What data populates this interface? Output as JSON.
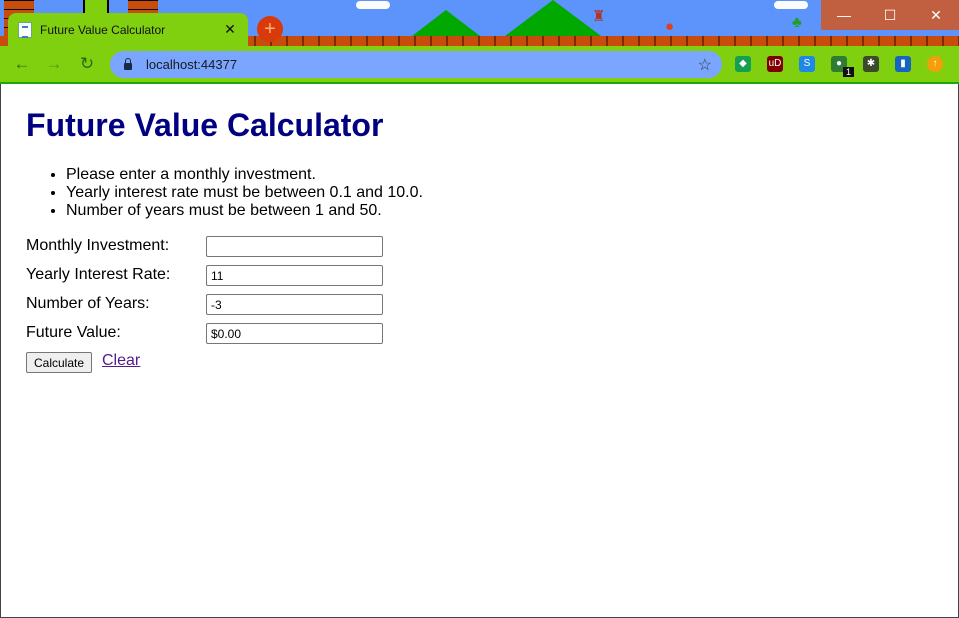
{
  "browser": {
    "tab_title": "Future Value Calculator",
    "tab_close_glyph": "✕",
    "new_tab_glyph": "+",
    "url": "localhost:44377",
    "window_controls": {
      "minimize": "—",
      "maximize": "☐",
      "close": "✕"
    },
    "nav": {
      "back": "←",
      "forward": "→",
      "reload": "↻"
    },
    "star_glyph": "☆",
    "extensions": [
      {
        "name": "green-extension-icon",
        "glyph": "◆",
        "color": "#14a050"
      },
      {
        "name": "ublock-icon",
        "glyph": "uD",
        "color": "#800000"
      },
      {
        "name": "s-extension-icon",
        "glyph": "S",
        "color": "#1e88e5"
      },
      {
        "name": "tampermonkey-icon",
        "glyph": "●",
        "color": "#2e7d32",
        "badge": "1"
      },
      {
        "name": "puzzle-extensions-icon",
        "glyph": "✱",
        "color": "#3a4a2a"
      },
      {
        "name": "profile-avatar-icon",
        "glyph": "▮",
        "color": "#1565c0"
      },
      {
        "name": "update-icon",
        "glyph": "↑",
        "color": "#f59e0b"
      }
    ]
  },
  "page": {
    "heading": "Future Value Calculator",
    "errors": [
      "Please enter a monthly investment.",
      "Yearly interest rate must be between 0.1 and 10.0.",
      "Number of years must be between 1 and 50."
    ],
    "fields": [
      {
        "label": "Monthly Investment:",
        "value": ""
      },
      {
        "label": "Yearly Interest Rate:",
        "value": "11"
      },
      {
        "label": "Number of Years:",
        "value": "-3"
      },
      {
        "label": "Future Value:",
        "value": "$0.00"
      }
    ],
    "calculate_label": "Calculate",
    "clear_label": "Clear"
  },
  "colors": {
    "heading": "#000080",
    "theme_green": "#80d010",
    "sky": "#5c94fc",
    "omnibox": "#7aa6ff"
  }
}
